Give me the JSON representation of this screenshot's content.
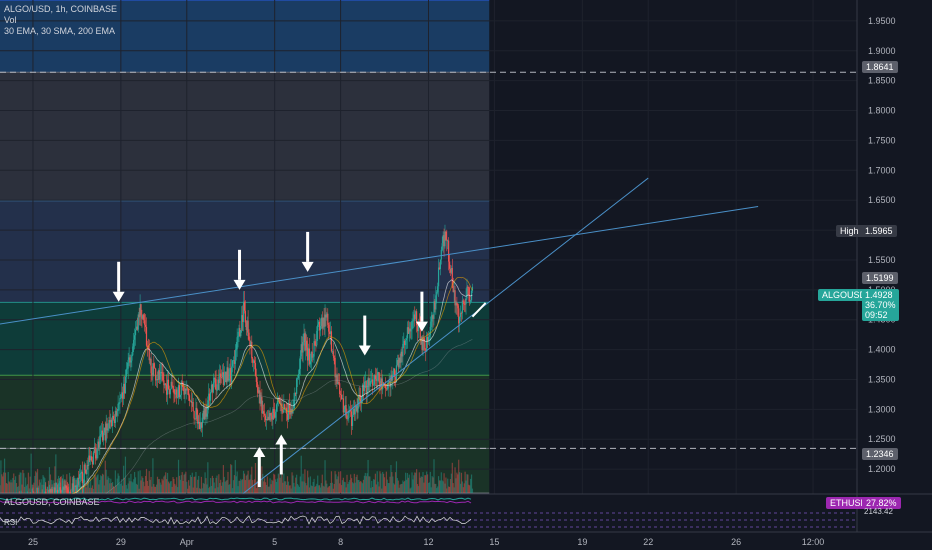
{
  "header": {
    "symbol_line": "ALGO/USD, 1h, COINBASE",
    "volume_label": "Vol",
    "indicators_line": "30 EMA, 30 SMA, 200 EMA"
  },
  "sub_panel": {
    "title": "ALGOUSD, COINBASE",
    "rsi_label": "RSI"
  },
  "price_badges": {
    "high_label": "High",
    "high_value": "1.5965",
    "level_upper": "1.8641",
    "level_mid": "1.5199",
    "level_lower": "1.2346",
    "current_label": "ALGOUSD",
    "current_value": "1.4928",
    "change": "36.70%",
    "countdown": "09:52",
    "eth_label": "ETHUSD",
    "eth_value": "27.82%",
    "eth_sub": "2143.42"
  },
  "colors": {
    "background": "#131722",
    "up": "#26a69a",
    "down": "#ef5350",
    "ema30": "#ffffff",
    "sma30": "#f7a600",
    "fib_blue": "#1e4a7a",
    "fib_gray": "#363a45",
    "fib_slate": "#2a3a5a",
    "fib_teal": "#0d4a42",
    "fib_green": "#1d3d2a",
    "trend_line": "#4a90c8",
    "badge_current": "#26a69a",
    "badge_high": "#363a45",
    "badge_eth": "#9c27b0"
  },
  "chart_data": {
    "type": "candlestick",
    "y_ticks": [
      1.95,
      1.9,
      1.85,
      1.8,
      1.75,
      1.7,
      1.65,
      1.6,
      1.55,
      1.5,
      1.45,
      1.4,
      1.35,
      1.3,
      1.25,
      1.2
    ],
    "y_tick_labels": [
      "1.9500",
      "1.9000",
      "1.8500",
      "1.8000",
      "1.7500",
      "1.7000",
      "1.6500",
      "1.6000",
      "1.5500",
      "1.5000",
      "1.4500",
      "1.4000",
      "1.3500",
      "1.3000",
      "1.2500",
      "1.2000"
    ],
    "ylim": [
      1.16,
      1.985
    ],
    "x_tick_labels": [
      "25",
      "29",
      "Apr",
      "5",
      "8",
      "12",
      "15",
      "19",
      "22",
      "26",
      "12:00"
    ],
    "x_tick_days": [
      -7,
      -3,
      0,
      4,
      7,
      11,
      14,
      18,
      21,
      25,
      28.5
    ],
    "xlim_days": [
      -8.5,
      30.5
    ],
    "fib_levels": [
      1.985,
      1.8641,
      1.649,
      1.479,
      1.357,
      1.2346,
      1.16
    ],
    "horizontal_levels": [
      1.8641,
      1.2346
    ],
    "price_points": [
      {
        "day": -10,
        "price": 1.12
      },
      {
        "day": -7,
        "price": 1.14
      },
      {
        "day": -5,
        "price": 1.17
      },
      {
        "day": -4.3,
        "price": 1.22
      },
      {
        "day": -3.6,
        "price": 1.27
      },
      {
        "day": -3,
        "price": 1.31
      },
      {
        "day": -2.3,
        "price": 1.44
      },
      {
        "day": -2.1,
        "price": 1.47
      },
      {
        "day": -1.6,
        "price": 1.37
      },
      {
        "day": -1,
        "price": 1.34
      },
      {
        "day": 0,
        "price": 1.33
      },
      {
        "day": 0.6,
        "price": 1.27
      },
      {
        "day": 1.2,
        "price": 1.34
      },
      {
        "day": 2,
        "price": 1.36
      },
      {
        "day": 2.6,
        "price": 1.47
      },
      {
        "day": 3.2,
        "price": 1.34
      },
      {
        "day": 3.6,
        "price": 1.27
      },
      {
        "day": 4.2,
        "price": 1.31
      },
      {
        "day": 4.8,
        "price": 1.29
      },
      {
        "day": 5.3,
        "price": 1.42
      },
      {
        "day": 5.6,
        "price": 1.38
      },
      {
        "day": 6,
        "price": 1.44
      },
      {
        "day": 6.4,
        "price": 1.45
      },
      {
        "day": 7,
        "price": 1.31
      },
      {
        "day": 7.5,
        "price": 1.28
      },
      {
        "day": 8,
        "price": 1.33
      },
      {
        "day": 8.6,
        "price": 1.36
      },
      {
        "day": 9,
        "price": 1.33
      },
      {
        "day": 9.6,
        "price": 1.37
      },
      {
        "day": 10,
        "price": 1.42
      },
      {
        "day": 10.4,
        "price": 1.46
      },
      {
        "day": 10.8,
        "price": 1.4
      },
      {
        "day": 11.2,
        "price": 1.45
      },
      {
        "day": 11.6,
        "price": 1.58
      },
      {
        "day": 11.8,
        "price": 1.59
      },
      {
        "day": 12.1,
        "price": 1.51
      },
      {
        "day": 12.4,
        "price": 1.45
      },
      {
        "day": 12.7,
        "price": 1.49
      },
      {
        "day": 13,
        "price": 1.4928
      }
    ],
    "trend_lines": [
      {
        "x1": -16,
        "y1": 1.4,
        "x2": 26,
        "y2": 1.6395
      },
      {
        "x1": 0.5,
        "y1": 1.1,
        "x2": 21,
        "y2": 1.687
      }
    ],
    "arrows_down": [
      {
        "day": -3.1,
        "tip": 1.48
      },
      {
        "day": 2.4,
        "tip": 1.5
      },
      {
        "day": 5.5,
        "tip": 1.53
      },
      {
        "day": 8.1,
        "tip": 1.39
      },
      {
        "day": 10.7,
        "tip": 1.43
      }
    ],
    "arrows_up": [
      {
        "day": 3.3,
        "tip": 1.237
      },
      {
        "day": 4.3,
        "tip": 1.258
      }
    ]
  }
}
